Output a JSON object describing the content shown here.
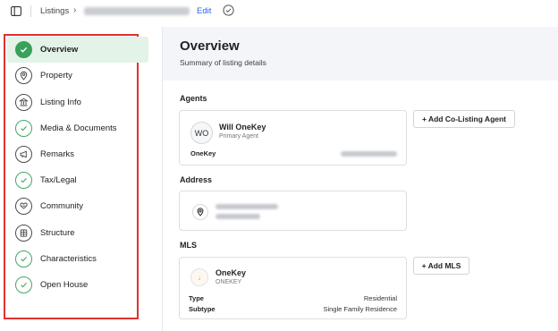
{
  "breadcrumb": {
    "listings": "Listings",
    "chevron": "›",
    "edit": "Edit"
  },
  "sidebar": {
    "items": [
      {
        "label": "Overview",
        "icon": "check-circle-icon",
        "active": true
      },
      {
        "label": "Property",
        "icon": "location-pin-icon"
      },
      {
        "label": "Listing Info",
        "icon": "bank-icon"
      },
      {
        "label": "Media & Documents",
        "icon": "check-circle-icon"
      },
      {
        "label": "Remarks",
        "icon": "megaphone-icon"
      },
      {
        "label": "Tax/Legal",
        "icon": "check-circle-icon"
      },
      {
        "label": "Community",
        "icon": "heart-hands-icon"
      },
      {
        "label": "Structure",
        "icon": "building-icon"
      },
      {
        "label": "Characteristics",
        "icon": "check-circle-icon"
      },
      {
        "label": "Open House",
        "icon": "check-circle-icon"
      }
    ]
  },
  "overview": {
    "title": "Overview",
    "subtitle": "Summary of listing details"
  },
  "agents": {
    "section_label": "Agents",
    "initials": "WO",
    "name": "Will OneKey",
    "role": "Primary Agent",
    "office": "OneKey",
    "add_button": "+ Add Co-Listing Agent"
  },
  "address": {
    "section_label": "Address"
  },
  "mls": {
    "section_label": "MLS",
    "logo_glyph": "↓",
    "name": "OneKey",
    "code": "ONEKEY",
    "type_label": "Type",
    "type_value": "Residential",
    "subtype_label": "Subtype",
    "subtype_value": "Single Family Residence",
    "add_button": "+ Add MLS"
  },
  "colors": {
    "accent_green": "#3aa05c",
    "active_bg": "#e3f3e7",
    "link_blue": "#2563eb",
    "highlight_red": "#e03030"
  }
}
